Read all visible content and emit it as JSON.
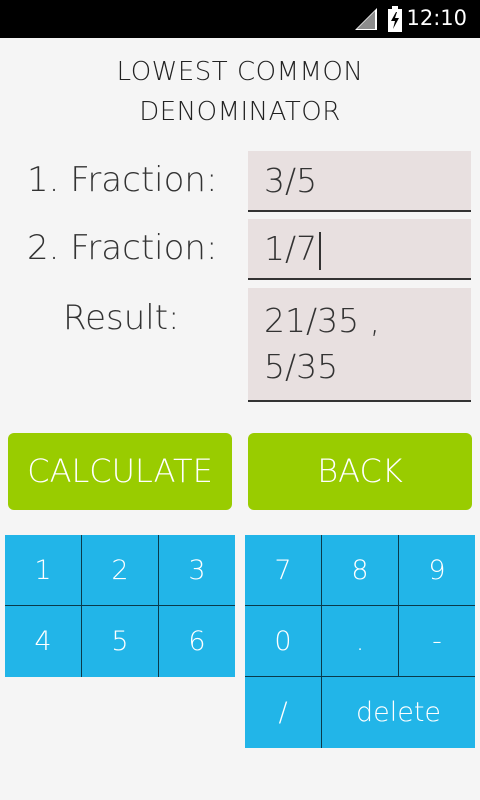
{
  "status_bar": {
    "time": "12:10",
    "signal_icon": "signal-icon",
    "battery_icon": "battery-charging-icon"
  },
  "title": {
    "line1": "LOWEST COMMON",
    "line2": "DENOMINATOR"
  },
  "form": {
    "fraction1_label": "1. Fraction:",
    "fraction1_value": "3/5",
    "fraction2_label": "2. Fraction:",
    "fraction2_value": "1/7",
    "result_label": "Result:",
    "result_line1": "21/35 ,",
    "result_line2": "5/35"
  },
  "buttons": {
    "calculate": "CALCULATE",
    "back": "BACK"
  },
  "keypad_left": [
    "1",
    "2",
    "3",
    "4",
    "5",
    "6"
  ],
  "keypad_right": [
    "7",
    "8",
    "9",
    "0",
    ".",
    "-",
    "/",
    "delete"
  ],
  "colors": {
    "button_green": "#99cc00",
    "keypad_blue": "#22b5e8",
    "field_bg": "#e8e0e0"
  }
}
